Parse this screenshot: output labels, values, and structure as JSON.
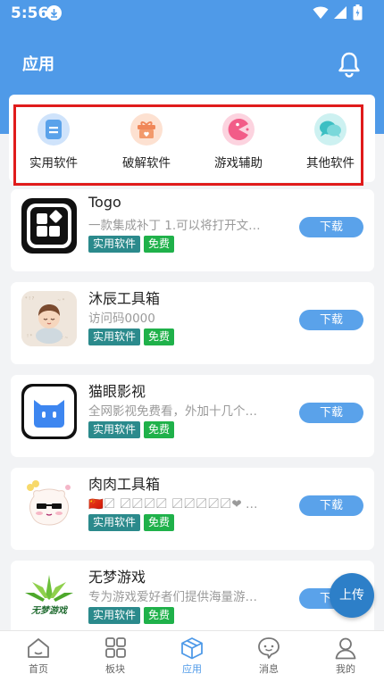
{
  "status_bar": {
    "time": "5:56"
  },
  "app_bar": {
    "title": "应用"
  },
  "categories": [
    {
      "label": "实用软件",
      "icon": "document-icon",
      "color": "#6fb0ee"
    },
    {
      "label": "破解软件",
      "icon": "gift-icon",
      "color": "#f29a6c"
    },
    {
      "label": "游戏辅助",
      "icon": "pacman-icon",
      "color": "#f46a92"
    },
    {
      "label": "其他软件",
      "icon": "chat-bubbles-icon",
      "color": "#57c9c9"
    }
  ],
  "apps": [
    {
      "name": "Togo",
      "desc": "一款集成补丁 1.可以将打开文…",
      "tag": "实用软件",
      "price": "免费",
      "button": "下载"
    },
    {
      "name": "沐辰工具箱",
      "desc": "访问码0000",
      "tag": "实用软件",
      "price": "免费",
      "button": "下载"
    },
    {
      "name": "猫眼影视",
      "desc": "全网影视免费看，外加十几个…",
      "tag": "实用软件",
      "price": "免费",
      "button": "下载"
    },
    {
      "name": "肉肉工具箱",
      "desc": "🇨🇳〼 〼〼〼〼 〼〼〼〼〼❤ …",
      "tag": "实用软件",
      "price": "免费",
      "button": "下载"
    },
    {
      "name": "无梦游戏",
      "desc": "专为游戏爱好者们提供海量游…",
      "tag": "实用软件",
      "price": "免费",
      "button": "下载",
      "icon_text": "无梦游戏"
    }
  ],
  "upload": {
    "label": "上传"
  },
  "bottom_nav": [
    {
      "label": "首页",
      "icon": "home-icon"
    },
    {
      "label": "板块",
      "icon": "grid-icon"
    },
    {
      "label": "应用",
      "icon": "cube-icon",
      "active": true
    },
    {
      "label": "消息",
      "icon": "message-icon"
    },
    {
      "label": "我的",
      "icon": "user-icon"
    }
  ],
  "colors": {
    "header": "#4f9ae8",
    "download_button": "#5aa2ea",
    "tag_category": "#2b8a8c",
    "tag_free": "#1fb14a",
    "highlight": "#e01b1b"
  }
}
